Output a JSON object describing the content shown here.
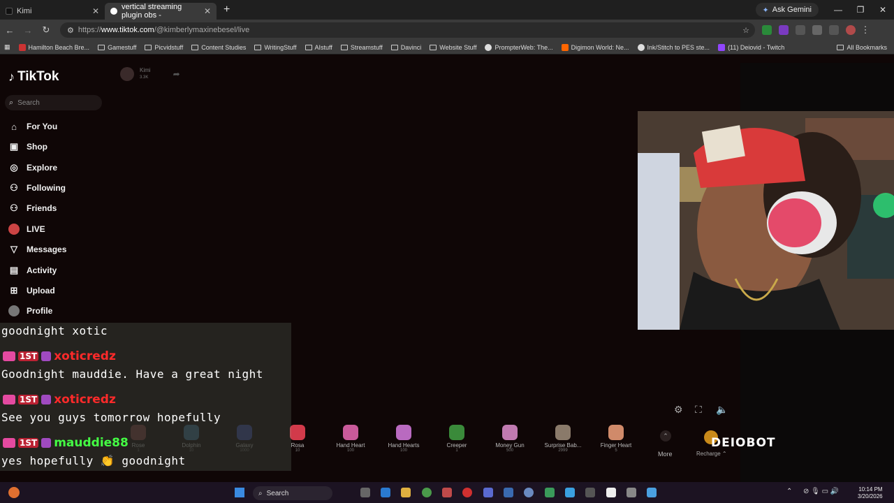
{
  "browser": {
    "tabs": [
      {
        "label": "Kimi",
        "active": false
      },
      {
        "label": "vertical streaming plugin obs -",
        "active": true
      }
    ],
    "ask_gemini": "Ask Gemini",
    "url_prefix": "https://",
    "url_domain": "www.tiktok.com",
    "url_path": "/@kimberlymaxinebesel/live",
    "bookmarks": [
      "Hamilton Beach Bre...",
      "Gamestuff",
      "Picvidstuff",
      "Content Studies",
      "WritingStuff",
      "AIstuff",
      "Streamstuff",
      "Davinci",
      "Website Stuff",
      "PrompterWeb: The...",
      "Digimon World: Ne...",
      "Ink/Stitch to PES ste...",
      "(11) Deiovid - Twitch"
    ],
    "all_bookmarks": "All Bookmarks"
  },
  "tiktok": {
    "logo": "TikTok",
    "search_placeholder": "Search",
    "nav": [
      "For You",
      "Shop",
      "Explore",
      "Following",
      "Friends",
      "LIVE",
      "Messages",
      "Activity",
      "Upload",
      "Profile"
    ],
    "host_name": "Kimi",
    "host_count": "3.3K"
  },
  "gifts": [
    {
      "name": "Rose",
      "coins": "1",
      "dim": true,
      "color": "#7a3a3a"
    },
    {
      "name": "Dolphin",
      "coins": "10",
      "dim": true,
      "color": "#3a6a8a"
    },
    {
      "name": "Galaxy",
      "coins": "1000",
      "dim": true,
      "color": "#3a4a9a"
    },
    {
      "name": "Rosa",
      "coins": "10",
      "dim": false,
      "color": "#d23a4a"
    },
    {
      "name": "Hand Heart",
      "coins": "100",
      "dim": false,
      "color": "#c95a9a"
    },
    {
      "name": "Hand Hearts",
      "coins": "100",
      "dim": false,
      "color": "#b96ac0"
    },
    {
      "name": "Creeper",
      "coins": "1",
      "dim": false,
      "color": "#3a8a3a"
    },
    {
      "name": "Money Gun",
      "coins": "500",
      "dim": false,
      "color": "#c07ab0"
    },
    {
      "name": "Surprise Bab...",
      "coins": "2999",
      "dim": false,
      "color": "#8a7a6a"
    },
    {
      "name": "Finger Heart",
      "coins": "5",
      "dim": false,
      "color": "#d08a6a"
    }
  ],
  "more_label": "More",
  "recharge_label": "Recharge",
  "deiobot": "DEIOBOT",
  "chat": [
    {
      "type": "msg",
      "text": "goodnight xotic"
    },
    {
      "type": "user",
      "name": "xoticredz",
      "color": "#ff2a2a"
    },
    {
      "type": "msg",
      "text": "Goodnight mauddie. Have a great night"
    },
    {
      "type": "user",
      "name": "xoticredz",
      "color": "#ff2a2a"
    },
    {
      "type": "msg",
      "text": "See you guys tomorrow hopefully"
    },
    {
      "type": "user",
      "name": "mauddie88",
      "color": "#44ff44"
    },
    {
      "type": "msg",
      "text": "yes hopefully 👏 goodnight"
    }
  ],
  "badge_first": "1ST",
  "taskbar": {
    "search": "Search",
    "time": "10:14 PM",
    "date": "3/20/2026"
  }
}
